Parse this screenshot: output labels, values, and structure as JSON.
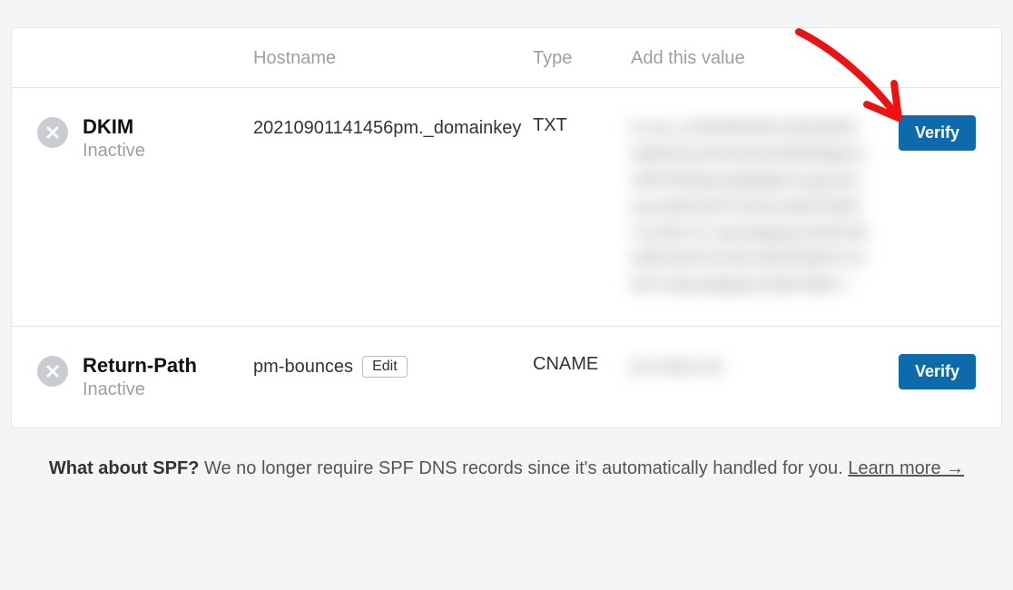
{
  "columns": {
    "hostname": "Hostname",
    "type": "Type",
    "value": "Add this value"
  },
  "records": [
    {
      "name": "DKIM",
      "status": "Inactive",
      "hostname": "20210901141456pm._domainkey",
      "type": "TXT",
      "value_redacted": "k=rsa; p=MIGfMA0GCSqGSIb3DQEBAQUAA4GNADCBiQKBgQ1234567890abcdefghijklmnopqrstuvwxyzABCDEFGHIJKLMNOPQRSTUVWXYZ+/abcdefghij1234567890ABCDEFGHIJKLMNOPQRSTUVWXYZabcdefghij1234567890==",
      "verify_label": "Verify"
    },
    {
      "name": "Return-Path",
      "status": "Inactive",
      "hostname": "pm-bounces",
      "edit_label": "Edit",
      "type": "CNAME",
      "value_redacted": "pm.mtasv.net",
      "verify_label": "Verify"
    }
  ],
  "spf": {
    "lead": "What about SPF?",
    "body": "We no longer require SPF DNS records since it's automatically handled for you.",
    "link": "Learn more →"
  }
}
